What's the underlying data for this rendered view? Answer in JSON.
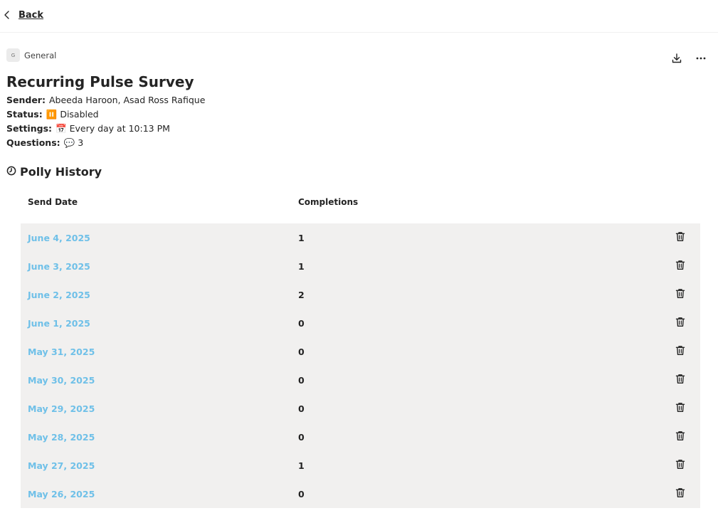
{
  "nav": {
    "back_label": "Back"
  },
  "category": {
    "badge": "G",
    "label": "General"
  },
  "actions": {
    "download_icon": "download-icon",
    "more_icon": "more-horizontal-icon"
  },
  "survey": {
    "title": "Recurring Pulse Survey",
    "sender_label": "Sender:",
    "sender_value": "Abeeda Haroon, Asad Ross Rafique",
    "status_label": "Status:",
    "status_emoji": "⏸️",
    "status_value": "Disabled",
    "settings_label": "Settings:",
    "settings_emoji": "📅",
    "settings_value": "Every day at 10:13 PM",
    "questions_label": "Questions:",
    "questions_emoji": "💬",
    "questions_value": "3"
  },
  "history": {
    "title": "Polly History",
    "icon": "clock-icon",
    "columns": {
      "send_date": "Send Date",
      "completions": "Completions"
    },
    "rows": [
      {
        "date": "June 4, 2025",
        "completions": "1"
      },
      {
        "date": "June 3, 2025",
        "completions": "1"
      },
      {
        "date": "June 2, 2025",
        "completions": "2"
      },
      {
        "date": "June 1, 2025",
        "completions": "0"
      },
      {
        "date": "May 31, 2025",
        "completions": "0"
      },
      {
        "date": "May 30, 2025",
        "completions": "0"
      },
      {
        "date": "May 29, 2025",
        "completions": "0"
      },
      {
        "date": "May 28, 2025",
        "completions": "0"
      },
      {
        "date": "May 27, 2025",
        "completions": "1"
      },
      {
        "date": "May 26, 2025",
        "completions": "0"
      }
    ]
  },
  "colors": {
    "link": "#6fc0e8",
    "table_background": "#f1f0ef",
    "text": "#242424"
  }
}
